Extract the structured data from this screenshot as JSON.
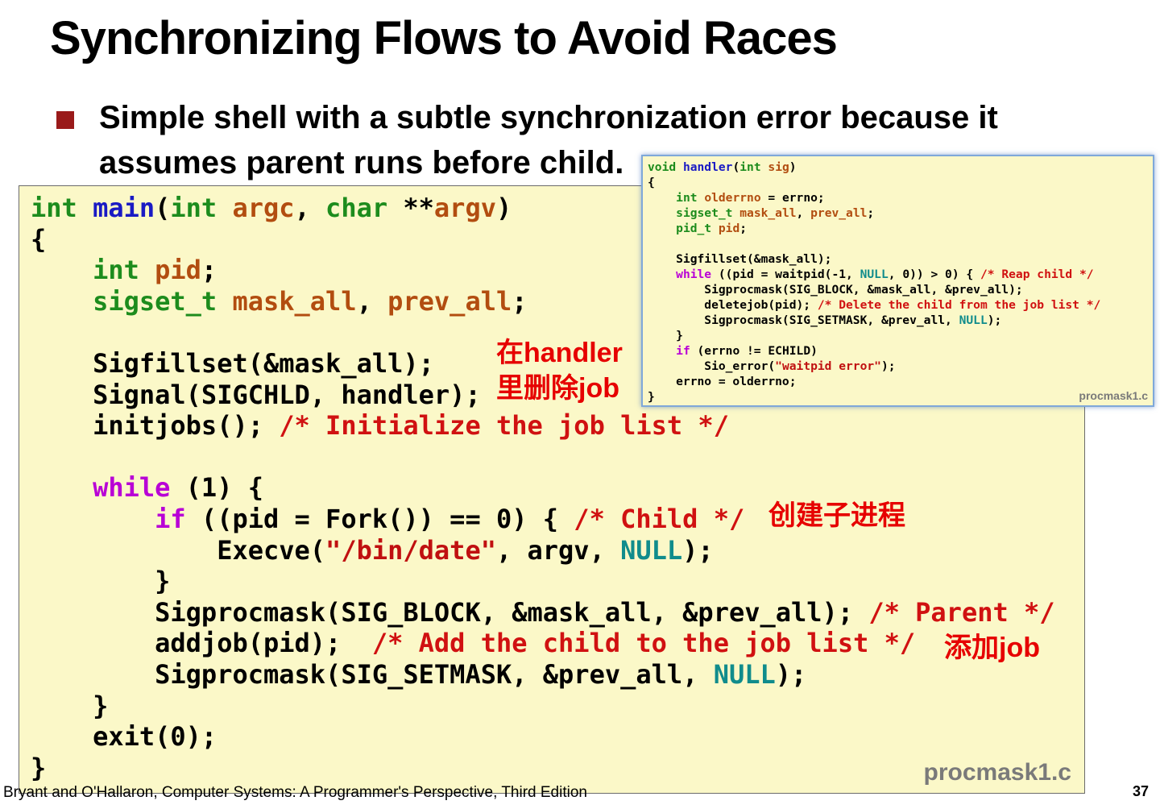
{
  "slide": {
    "title": "Synchronizing Flows to Avoid Races",
    "bullet": "Simple shell with a subtle synchronization error because it assumes parent runs before child.",
    "footer": "Bryant and O'Hallaron, Computer Systems: A Programmer's Perspective, Third Edition",
    "page_number": "37"
  },
  "main_code": {
    "filename": "procmask1.c",
    "l1": {
      "t1": "int",
      "t2": " ",
      "t3": "main",
      "t4": "(",
      "t5": "int",
      "t6": " ",
      "t7": "argc",
      "t8": ", ",
      "t9": "char",
      "t10": " **",
      "t11": "argv",
      "t12": ")"
    },
    "l2": {
      "t1": "{"
    },
    "l3": {
      "t1": "    ",
      "t2": "int",
      "t3": " ",
      "t4": "pid",
      "t5": ";"
    },
    "l4": {
      "t1": "    ",
      "t2": "sigset_t",
      "t3": " ",
      "t4": "mask_all",
      "t5": ", ",
      "t6": "prev_all",
      "t7": ";"
    },
    "l5": {
      "t1": ""
    },
    "l6": {
      "t1": "    Sigfillset(&mask_all);"
    },
    "l7": {
      "t1": "    Signal(SIGCHLD, handler);"
    },
    "l8": {
      "t1": "    initjobs(); ",
      "t2": "/* Initialize the job list */"
    },
    "l9": {
      "t1": ""
    },
    "l10": {
      "t1": "    ",
      "t2": "while",
      "t3": " (1) {"
    },
    "l11": {
      "t1": "        ",
      "t2": "if",
      "t3": " ((pid = Fork()) == 0) { ",
      "t4": "/* Child */"
    },
    "l12": {
      "t1": "            Execve(",
      "t2": "\"/bin/date\"",
      "t3": ", argv, ",
      "t4": "NULL",
      "t5": ");"
    },
    "l13": {
      "t1": "        }"
    },
    "l14": {
      "t1": "        Sigprocmask(SIG_BLOCK, &mask_all, &prev_all); ",
      "t2": "/* Parent */"
    },
    "l15": {
      "t1": "        addjob(pid);  ",
      "t2": "/* Add the child to the job list */"
    },
    "l16": {
      "t1": "        Sigprocmask(SIG_SETMASK, &prev_all, ",
      "t2": "NULL",
      "t3": ");"
    },
    "l17": {
      "t1": "    }"
    },
    "l18": {
      "t1": "    exit(0);"
    },
    "l19": {
      "t1": "}"
    }
  },
  "handler_code": {
    "filename": "procmask1.c",
    "l1": {
      "t1": "void",
      "t2": " ",
      "t3": "handler",
      "t4": "(",
      "t5": "int",
      "t6": " ",
      "t7": "sig",
      "t8": ")"
    },
    "l2": {
      "t1": "{"
    },
    "l3": {
      "t1": "    ",
      "t2": "int",
      "t3": " ",
      "t4": "olderrno",
      "t5": " = errno;"
    },
    "l4": {
      "t1": "    ",
      "t2": "sigset_t",
      "t3": " ",
      "t4": "mask_all",
      "t5": ", ",
      "t6": "prev_all",
      "t7": ";"
    },
    "l5": {
      "t1": "    ",
      "t2": "pid_t",
      "t3": " ",
      "t4": "pid",
      "t5": ";"
    },
    "l6": {
      "t1": ""
    },
    "l7": {
      "t1": "    Sigfillset(&mask_all);"
    },
    "l8": {
      "t1": "    ",
      "t2": "while",
      "t3": " ((pid = waitpid(-1, ",
      "t4": "NULL",
      "t5": ", 0)) > 0) { ",
      "t6": "/* Reap child */"
    },
    "l9": {
      "t1": "        Sigprocmask(SIG_BLOCK, &mask_all, &prev_all);"
    },
    "l10": {
      "t1": "        deletejob(pid); ",
      "t2": "/* Delete the child from the job list */"
    },
    "l11": {
      "t1": "        Sigprocmask(SIG_SETMASK, &prev_all, ",
      "t2": "NULL",
      "t3": ");"
    },
    "l12": {
      "t1": "    }"
    },
    "l13": {
      "t1": "    ",
      "t2": "if",
      "t3": " (errno != ECHILD)"
    },
    "l14": {
      "t1": "        Sio_error(",
      "t2": "\"waitpid error\"",
      "t3": ");"
    },
    "l15": {
      "t1": "    errno = olderrno;"
    },
    "l16": {
      "t1": "}"
    }
  },
  "annotations": {
    "handler_delete_line1": "在handler",
    "handler_delete_line2": "里删除job",
    "create_child": "创建子进程",
    "add_job": "添加job"
  },
  "colors": {
    "type_keyword": "#1d8c1d",
    "function_name": "#1a1ac4",
    "identifier": "#b24d10",
    "control_keyword": "#b800d6",
    "comment": "#d01111",
    "null_constant": "#108c8c",
    "annotation": "#e60000",
    "code_background": "#fbf8c8"
  }
}
